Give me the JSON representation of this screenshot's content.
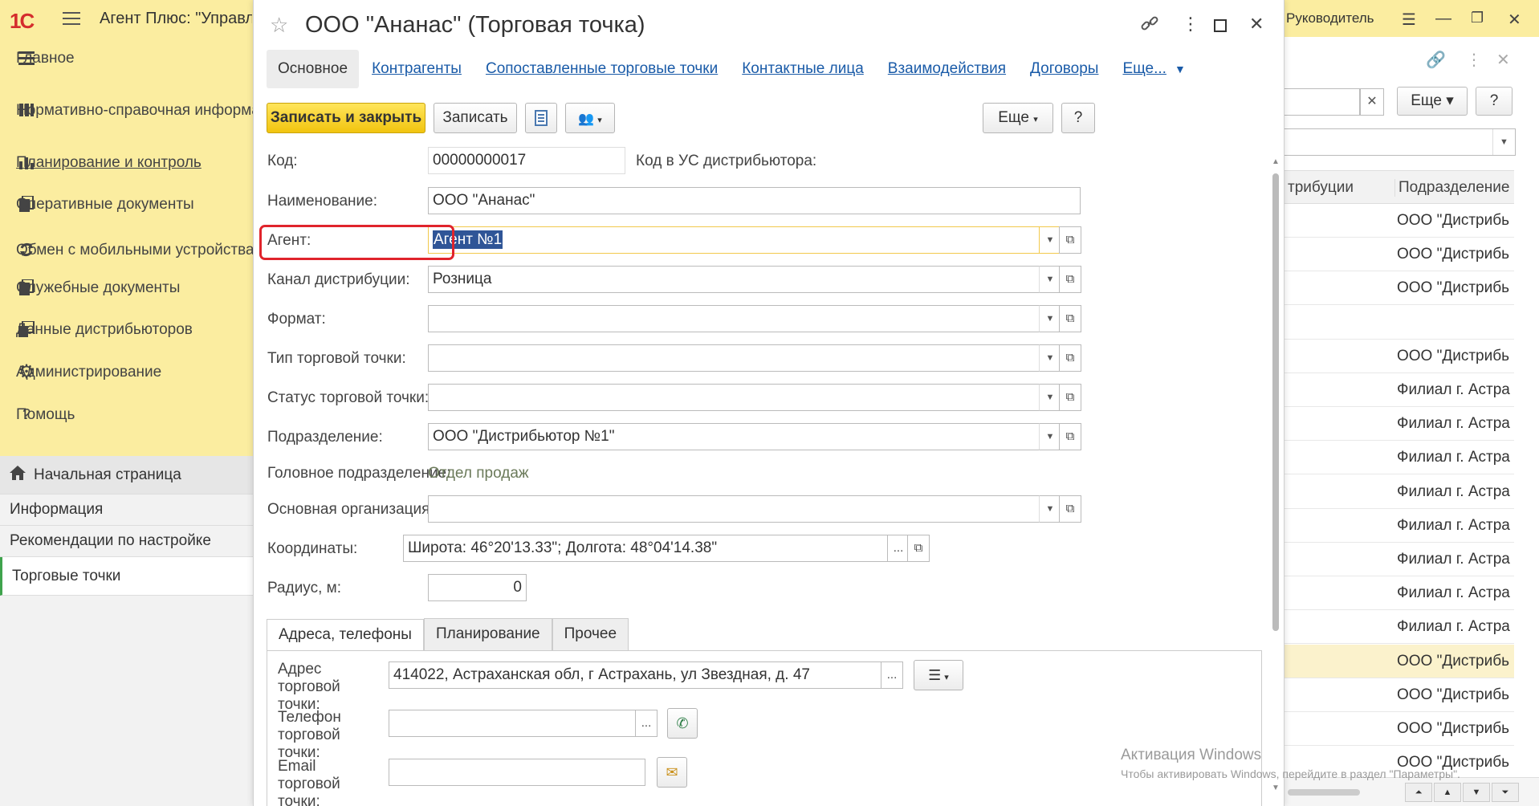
{
  "app": {
    "logo_text": "1С",
    "title": "Агент Плюс: \"Управл",
    "role": "Руководитель"
  },
  "sidebar": {
    "items": [
      {
        "label": "Главное",
        "icon": "hamburger-icon"
      },
      {
        "label": "Нормативно-справочная информация",
        "icon": "reference-icon"
      },
      {
        "label": "Планирование и контроль",
        "icon": "chart-icon"
      },
      {
        "label": "Оперативные документы",
        "icon": "documents-icon"
      },
      {
        "label": "Обмен с мобильными устройствами",
        "icon": "sync-icon"
      },
      {
        "label": "Служебные документы",
        "icon": "service-docs-icon"
      },
      {
        "label": "Данные дистрибьюторов",
        "icon": "distributor-data-icon"
      },
      {
        "label": "Администрирование",
        "icon": "gear-icon"
      },
      {
        "label": "Помощь",
        "icon": "help-icon"
      }
    ]
  },
  "subnav": {
    "items": [
      {
        "label": "Начальная страница",
        "icon": "home-icon"
      },
      {
        "label": "Информация"
      },
      {
        "label": "Рекомендации по настройке"
      },
      {
        "label": "Торговые точки"
      }
    ]
  },
  "dialog": {
    "title": "ООО \"Ананас\" (Торговая точка)",
    "tabs": [
      {
        "label": "Основное"
      },
      {
        "label": "Контрагенты"
      },
      {
        "label": "Сопоставленные торговые точки"
      },
      {
        "label": "Контактные лица"
      },
      {
        "label": "Взаимодействия"
      },
      {
        "label": "Договоры"
      },
      {
        "label": "Еще..."
      }
    ],
    "toolbar": {
      "save_close": "Записать и закрыть",
      "save": "Записать",
      "more": "Еще",
      "help": "?"
    },
    "fields": {
      "code_label": "Код:",
      "code_value": "00000000017",
      "us_code_label": "Код в УС дистрибьютора:",
      "name_label": "Наименование:",
      "name_value": "ООО \"Ананас\"",
      "agent_label": "Агент:",
      "agent_value": "Агент №1",
      "channel_label": "Канал дистрибуции:",
      "channel_value": "Розница",
      "format_label": "Формат:",
      "format_value": "",
      "type_label": "Тип торговой точки:",
      "type_value": "",
      "status_label": "Статус торговой точки:",
      "status_value": "",
      "division_label": "Подразделение:",
      "division_value": "ООО \"Дистрибьютор №1\"",
      "head_division_label": "Головное подразделение:",
      "head_division_value": "Отдел продаж",
      "org_label": "Основная организация:",
      "org_value": "",
      "coords_label": "Координаты:",
      "coords_value": "Широта: 46°20'13.33\"; Долгота: 48°04'14.38\"",
      "radius_label": "Радиус, м:",
      "radius_value": "0"
    },
    "inner_tabs": [
      {
        "label": "Адреса, телефоны"
      },
      {
        "label": "Планирование"
      },
      {
        "label": "Прочее"
      }
    ],
    "address": {
      "addr_label": "Адрес торговой точки:",
      "addr_value": "414022, Астраханская обл, г Астрахань, ул Звездная, д. 47",
      "phone_label": "Телефон торговой точки:",
      "phone_value": "",
      "email_label": "Email торговой точки:",
      "email_value": ""
    },
    "ellipsis": "..."
  },
  "right_list": {
    "more": "Еще",
    "help": "?",
    "col1": "трибуции",
    "col2": "Подразделение",
    "rows": [
      "ООО \"Дистрибь",
      "ООО \"Дистрибь",
      "ООО \"Дистрибь",
      "",
      "ООО \"Дистрибь",
      "Филиал г. Астра",
      "Филиал г. Астра",
      "Филиал г. Астра",
      "Филиал г. Астра",
      "Филиал г. Астра",
      "Филиал г. Астра",
      "Филиал г. Астра",
      "Филиал г. Астра",
      "ООО \"Дистрибь",
      "ООО \"Дистрибь",
      "ООО \"Дистрибь",
      "ООО \"Дистрибь"
    ]
  },
  "watermark": {
    "title": "Активация Windows",
    "subtitle": "Чтобы активировать Windows, перейдите в раздел \"Параметры\"."
  },
  "colors": {
    "sidebar_bg": "#fbeda0",
    "primary_button": "#f1c40f",
    "link": "#1a5ba8",
    "highlight": "#e0242c",
    "active_subnav": "#3fa34d"
  }
}
